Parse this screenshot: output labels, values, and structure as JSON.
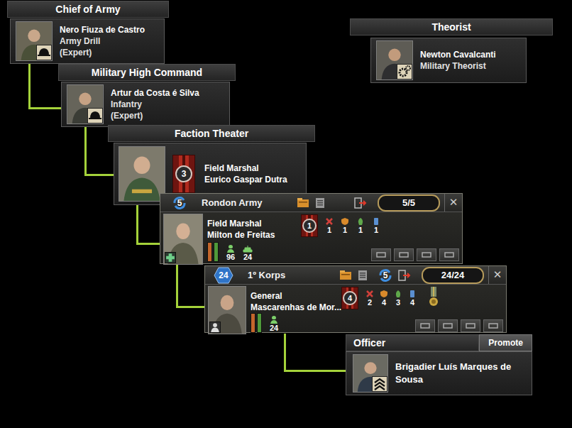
{
  "chief_of_army": {
    "header": "Chief of Army",
    "name": "Nero Fiuza de Castro",
    "trait": "Army Drill",
    "level": "(Expert)"
  },
  "high_command": {
    "header": "Military High Command",
    "name": "Artur da Costa é Silva",
    "trait": "Infantry",
    "level": "(Expert)"
  },
  "theorist": {
    "header": "Theorist",
    "name": "Newton Cavalcanti",
    "trait": "Military Theorist"
  },
  "faction_theater": {
    "header": "Faction Theater",
    "rank": "Field Marshal",
    "name": "Eurico Gaspar Dutra",
    "skill": "3"
  },
  "army": {
    "badge": "5",
    "name": "Rondon Army",
    "counter": "5/5",
    "close": "✕",
    "rank": "Field Marshal",
    "commander": "Milton de Freitas",
    "skill": "1",
    "stats": [
      {
        "kind": "attack",
        "value": "1",
        "color": "#d0403a"
      },
      {
        "kind": "defense",
        "value": "1",
        "color": "#d98a2b"
      },
      {
        "kind": "planning",
        "value": "1",
        "color": "#5fa84a"
      },
      {
        "kind": "logistics",
        "value": "1",
        "color": "#5a8fd0"
      }
    ],
    "bars": [
      {
        "level": 1,
        "color": "#c4662c"
      },
      {
        "level": 1,
        "color": "#4f9a3a"
      }
    ],
    "counts": [
      {
        "kind": "infantry",
        "value": "96"
      },
      {
        "kind": "vehicle",
        "value": "24"
      }
    ]
  },
  "corps": {
    "badge": "24",
    "name": "1º Korps",
    "queue": "5",
    "counter": "24/24",
    "close": "✕",
    "rank": "General",
    "commander": "Mascarenhas de Mor...",
    "skill": "4",
    "stats": [
      {
        "kind": "attack",
        "value": "2",
        "color": "#d0403a"
      },
      {
        "kind": "defense",
        "value": "4",
        "color": "#d98a2b"
      },
      {
        "kind": "planning",
        "value": "3",
        "color": "#5fa84a"
      },
      {
        "kind": "logistics",
        "value": "4",
        "color": "#5a8fd0"
      }
    ],
    "bars": [
      {
        "level": 1,
        "color": "#c4662c"
      },
      {
        "level": 1,
        "color": "#4f9a3a"
      }
    ],
    "counts": [
      {
        "kind": "infantry",
        "value": "24"
      }
    ]
  },
  "officer": {
    "header": "Officer",
    "button": "Promote",
    "name": "Brigadier Luís Marques de Sousa"
  }
}
